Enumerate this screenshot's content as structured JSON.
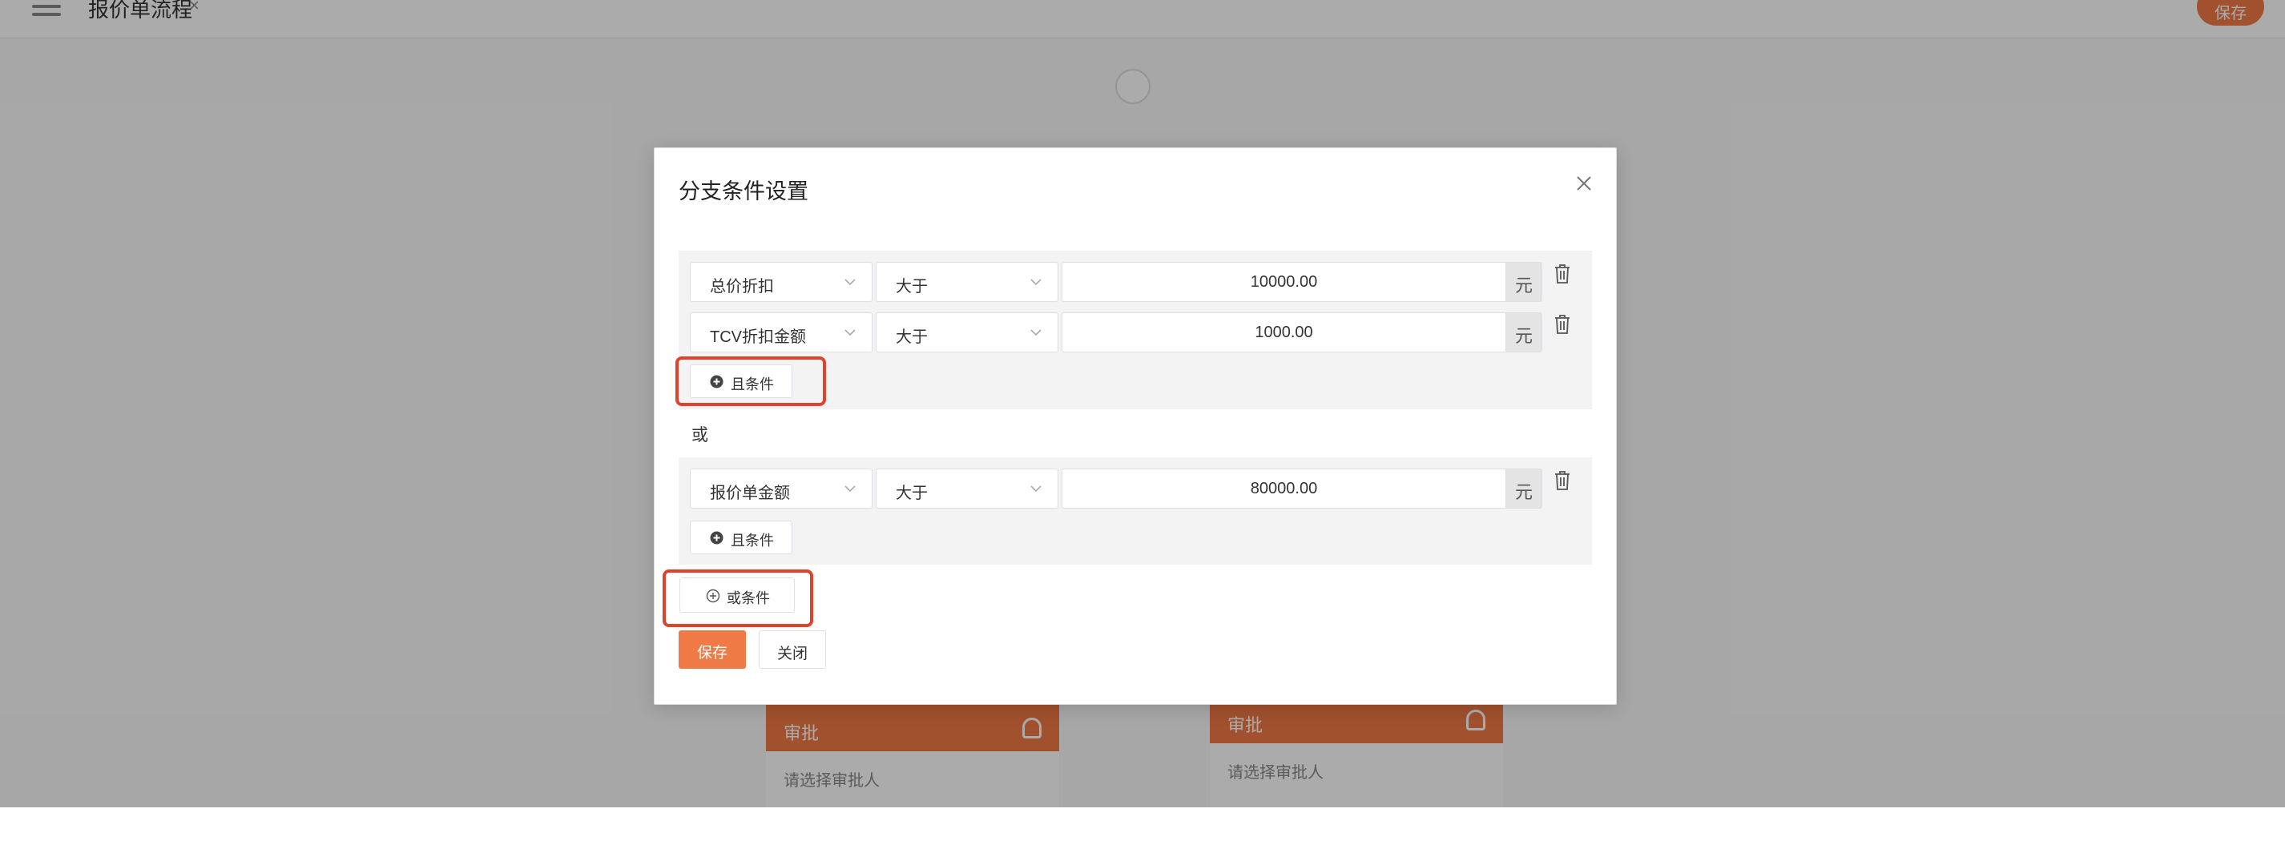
{
  "background": {
    "title": "报价单流程",
    "close_glyph": "×",
    "top_button": "保存",
    "nodes": [
      {
        "head": "审批",
        "body": "请选择审批人"
      },
      {
        "head": "审批",
        "body": "请选择审批人"
      }
    ]
  },
  "modal": {
    "title": "分支条件设置",
    "close_label": "×",
    "groups": [
      {
        "rows": [
          {
            "field": "总价折扣",
            "operator": "大于",
            "value": "10000.00",
            "unit": "元"
          },
          {
            "field": "TCV折扣金额",
            "operator": "大于",
            "value": "1000.00",
            "unit": "元"
          }
        ],
        "add_and_label": "且条件"
      },
      {
        "rows": [
          {
            "field": "报价单金额",
            "operator": "大于",
            "value": "80000.00",
            "unit": "元"
          }
        ],
        "add_and_label": "且条件"
      }
    ],
    "or_separator": "或",
    "add_or_label": "或条件",
    "save_label": "保存",
    "close_button_label": "关闭"
  },
  "colors": {
    "accent": "#f07a45",
    "highlight": "#e0432b"
  },
  "icons": [
    "close-icon",
    "chevron-down-icon",
    "trash-icon",
    "plus-circle-filled-icon",
    "plus-circle-outline-icon"
  ]
}
